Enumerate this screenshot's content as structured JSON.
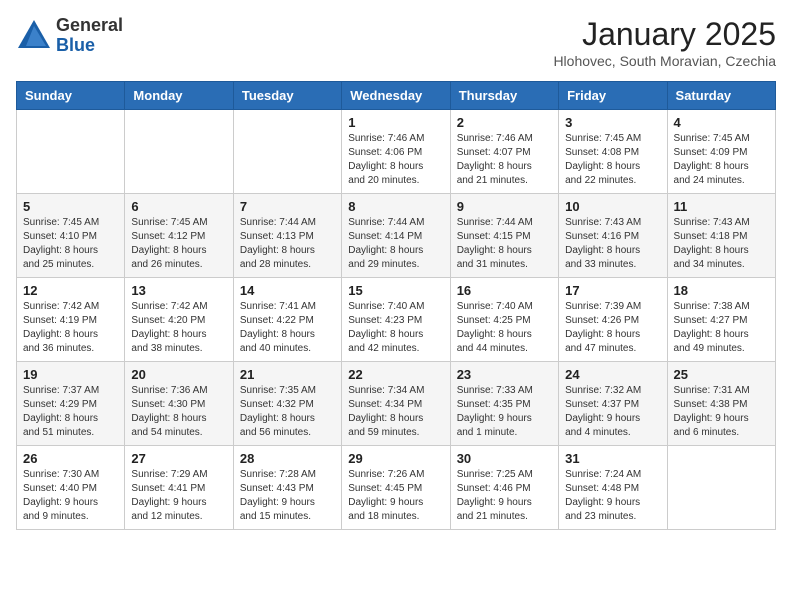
{
  "header": {
    "logo_general": "General",
    "logo_blue": "Blue",
    "month_title": "January 2025",
    "location": "Hlohovec, South Moravian, Czechia"
  },
  "weekdays": [
    "Sunday",
    "Monday",
    "Tuesday",
    "Wednesday",
    "Thursday",
    "Friday",
    "Saturday"
  ],
  "weeks": [
    [
      {
        "day": "",
        "info": ""
      },
      {
        "day": "",
        "info": ""
      },
      {
        "day": "",
        "info": ""
      },
      {
        "day": "1",
        "info": "Sunrise: 7:46 AM\nSunset: 4:06 PM\nDaylight: 8 hours\nand 20 minutes."
      },
      {
        "day": "2",
        "info": "Sunrise: 7:46 AM\nSunset: 4:07 PM\nDaylight: 8 hours\nand 21 minutes."
      },
      {
        "day": "3",
        "info": "Sunrise: 7:45 AM\nSunset: 4:08 PM\nDaylight: 8 hours\nand 22 minutes."
      },
      {
        "day": "4",
        "info": "Sunrise: 7:45 AM\nSunset: 4:09 PM\nDaylight: 8 hours\nand 24 minutes."
      }
    ],
    [
      {
        "day": "5",
        "info": "Sunrise: 7:45 AM\nSunset: 4:10 PM\nDaylight: 8 hours\nand 25 minutes."
      },
      {
        "day": "6",
        "info": "Sunrise: 7:45 AM\nSunset: 4:12 PM\nDaylight: 8 hours\nand 26 minutes."
      },
      {
        "day": "7",
        "info": "Sunrise: 7:44 AM\nSunset: 4:13 PM\nDaylight: 8 hours\nand 28 minutes."
      },
      {
        "day": "8",
        "info": "Sunrise: 7:44 AM\nSunset: 4:14 PM\nDaylight: 8 hours\nand 29 minutes."
      },
      {
        "day": "9",
        "info": "Sunrise: 7:44 AM\nSunset: 4:15 PM\nDaylight: 8 hours\nand 31 minutes."
      },
      {
        "day": "10",
        "info": "Sunrise: 7:43 AM\nSunset: 4:16 PM\nDaylight: 8 hours\nand 33 minutes."
      },
      {
        "day": "11",
        "info": "Sunrise: 7:43 AM\nSunset: 4:18 PM\nDaylight: 8 hours\nand 34 minutes."
      }
    ],
    [
      {
        "day": "12",
        "info": "Sunrise: 7:42 AM\nSunset: 4:19 PM\nDaylight: 8 hours\nand 36 minutes."
      },
      {
        "day": "13",
        "info": "Sunrise: 7:42 AM\nSunset: 4:20 PM\nDaylight: 8 hours\nand 38 minutes."
      },
      {
        "day": "14",
        "info": "Sunrise: 7:41 AM\nSunset: 4:22 PM\nDaylight: 8 hours\nand 40 minutes."
      },
      {
        "day": "15",
        "info": "Sunrise: 7:40 AM\nSunset: 4:23 PM\nDaylight: 8 hours\nand 42 minutes."
      },
      {
        "day": "16",
        "info": "Sunrise: 7:40 AM\nSunset: 4:25 PM\nDaylight: 8 hours\nand 44 minutes."
      },
      {
        "day": "17",
        "info": "Sunrise: 7:39 AM\nSunset: 4:26 PM\nDaylight: 8 hours\nand 47 minutes."
      },
      {
        "day": "18",
        "info": "Sunrise: 7:38 AM\nSunset: 4:27 PM\nDaylight: 8 hours\nand 49 minutes."
      }
    ],
    [
      {
        "day": "19",
        "info": "Sunrise: 7:37 AM\nSunset: 4:29 PM\nDaylight: 8 hours\nand 51 minutes."
      },
      {
        "day": "20",
        "info": "Sunrise: 7:36 AM\nSunset: 4:30 PM\nDaylight: 8 hours\nand 54 minutes."
      },
      {
        "day": "21",
        "info": "Sunrise: 7:35 AM\nSunset: 4:32 PM\nDaylight: 8 hours\nand 56 minutes."
      },
      {
        "day": "22",
        "info": "Sunrise: 7:34 AM\nSunset: 4:34 PM\nDaylight: 8 hours\nand 59 minutes."
      },
      {
        "day": "23",
        "info": "Sunrise: 7:33 AM\nSunset: 4:35 PM\nDaylight: 9 hours\nand 1 minute."
      },
      {
        "day": "24",
        "info": "Sunrise: 7:32 AM\nSunset: 4:37 PM\nDaylight: 9 hours\nand 4 minutes."
      },
      {
        "day": "25",
        "info": "Sunrise: 7:31 AM\nSunset: 4:38 PM\nDaylight: 9 hours\nand 6 minutes."
      }
    ],
    [
      {
        "day": "26",
        "info": "Sunrise: 7:30 AM\nSunset: 4:40 PM\nDaylight: 9 hours\nand 9 minutes."
      },
      {
        "day": "27",
        "info": "Sunrise: 7:29 AM\nSunset: 4:41 PM\nDaylight: 9 hours\nand 12 minutes."
      },
      {
        "day": "28",
        "info": "Sunrise: 7:28 AM\nSunset: 4:43 PM\nDaylight: 9 hours\nand 15 minutes."
      },
      {
        "day": "29",
        "info": "Sunrise: 7:26 AM\nSunset: 4:45 PM\nDaylight: 9 hours\nand 18 minutes."
      },
      {
        "day": "30",
        "info": "Sunrise: 7:25 AM\nSunset: 4:46 PM\nDaylight: 9 hours\nand 21 minutes."
      },
      {
        "day": "31",
        "info": "Sunrise: 7:24 AM\nSunset: 4:48 PM\nDaylight: 9 hours\nand 23 minutes."
      },
      {
        "day": "",
        "info": ""
      }
    ]
  ]
}
